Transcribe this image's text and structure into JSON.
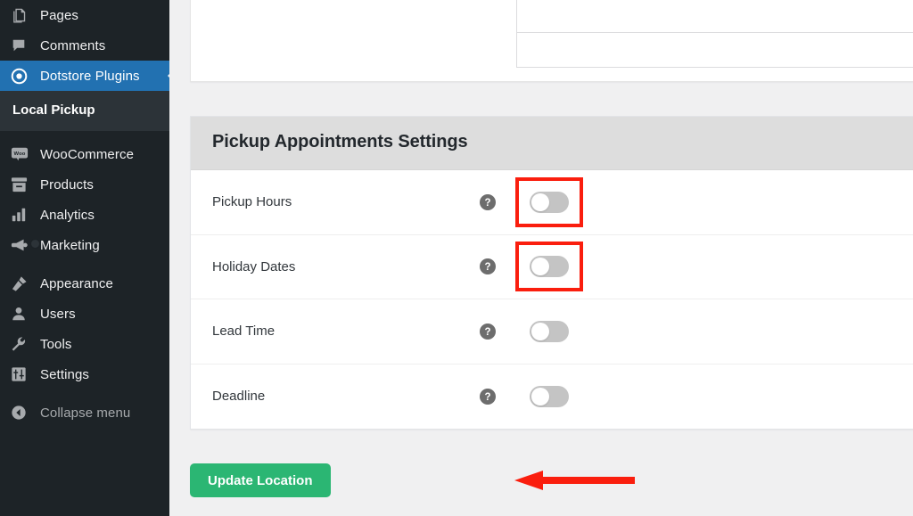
{
  "sidebar": {
    "items": [
      {
        "label": "Pages",
        "icon": "pages-icon",
        "active": false
      },
      {
        "label": "Comments",
        "icon": "comments-icon",
        "active": false
      },
      {
        "label": "Dotstore Plugins",
        "icon": "dotstore-icon",
        "active": true
      },
      {
        "label": "WooCommerce",
        "icon": "woocommerce-icon",
        "active": false
      },
      {
        "label": "Products",
        "icon": "products-icon",
        "active": false
      },
      {
        "label": "Analytics",
        "icon": "analytics-icon",
        "active": false
      },
      {
        "label": "Marketing",
        "icon": "marketing-icon",
        "active": false
      },
      {
        "label": "Appearance",
        "icon": "appearance-icon",
        "active": false
      },
      {
        "label": "Users",
        "icon": "users-icon",
        "active": false
      },
      {
        "label": "Tools",
        "icon": "tools-icon",
        "active": false
      },
      {
        "label": "Settings",
        "icon": "settings-icon",
        "active": false
      }
    ],
    "submenu": {
      "label": "Local Pickup"
    },
    "collapse": {
      "label": "Collapse menu",
      "icon": "collapse-icon"
    },
    "active_color": "#2271b1",
    "background_color": "#1d2327",
    "submenu_background": "#2c3338"
  },
  "main": {
    "card": {
      "title": "Pickup Appointments Settings",
      "header_color": "#dddddd",
      "rows": [
        {
          "label": "Pickup Hours",
          "help": "help-icon",
          "toggle": "off",
          "highlighted": true
        },
        {
          "label": "Holiday Dates",
          "help": "help-icon",
          "toggle": "off",
          "highlighted": true
        },
        {
          "label": "Lead Time",
          "help": "help-icon",
          "toggle": "off",
          "highlighted": false
        },
        {
          "label": "Deadline",
          "help": "help-icon",
          "toggle": "off",
          "highlighted": false
        }
      ]
    },
    "update_button": {
      "label": "Update Location",
      "color": "#2bb673"
    },
    "annotations": {
      "highlight_color": "#fa1e0e",
      "arrow": {
        "direction": "left",
        "color": "#fa1e0e",
        "points_to": "Update Location"
      }
    }
  }
}
